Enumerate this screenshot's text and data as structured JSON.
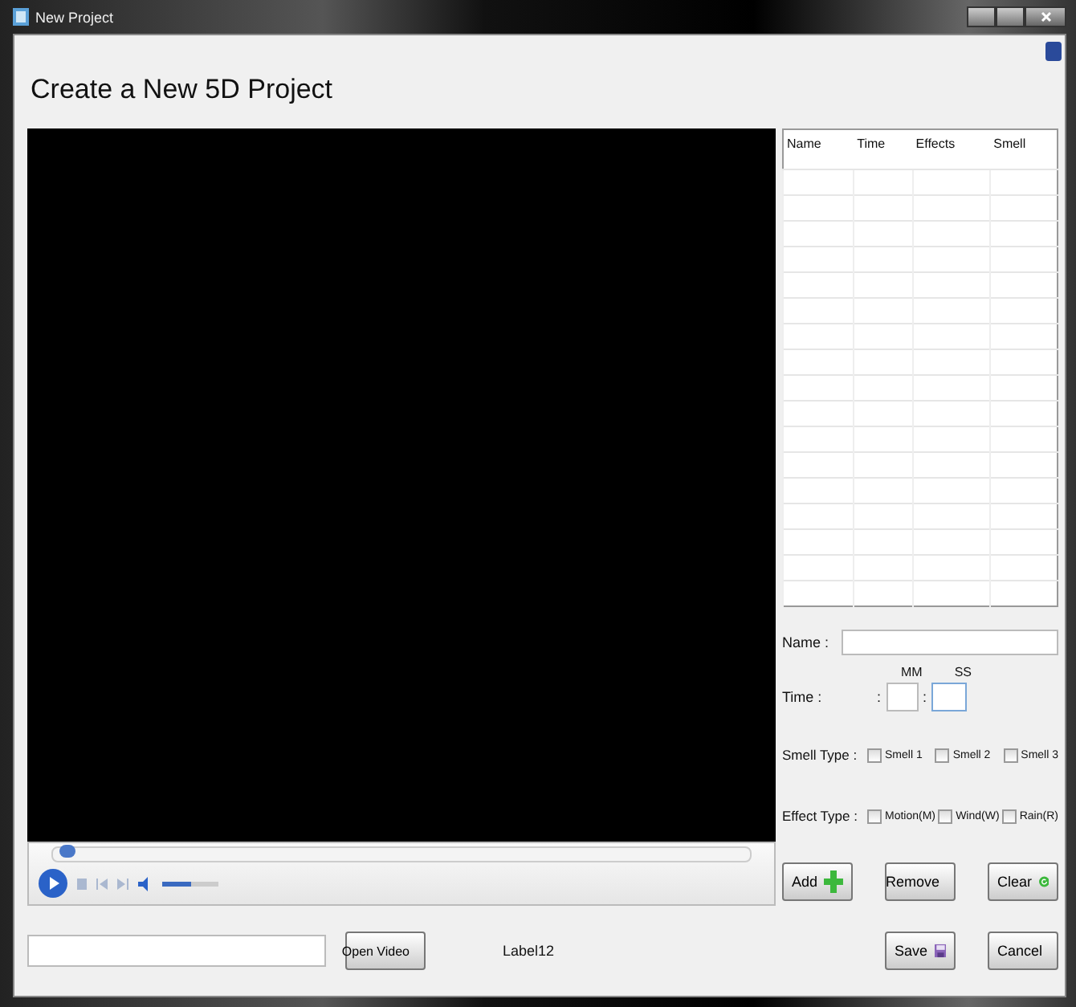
{
  "window": {
    "title": "New Project"
  },
  "heading": "Create a New 5D Project",
  "player": {
    "seek": {
      "level": 0.01
    },
    "volume": {
      "level": 0.5
    }
  },
  "table": {
    "columns": [
      "Name",
      "Time",
      "Effects",
      "Smell"
    ]
  },
  "name_field": {
    "label": "Name :"
  },
  "time": {
    "label": "Time :",
    "mm_label": "MM",
    "ss_label": "SS",
    "separator": ":"
  },
  "smell_type": {
    "label": "Smell Type :",
    "options": [
      {
        "label": "Smell 1",
        "checked": false
      },
      {
        "label": "Smell 2",
        "checked": false
      },
      {
        "label": "Smell 3",
        "checked": false
      }
    ]
  },
  "effect_type": {
    "label": "Effect Type :",
    "options": [
      {
        "label": "Motion(M)",
        "checked": false
      },
      {
        "label": "Wind(W)",
        "checked": false
      },
      {
        "label": "Rain(R)",
        "checked": false
      }
    ]
  },
  "list_buttons": [
    {
      "label": "Add",
      "kind": "add"
    },
    {
      "label": "Remove",
      "kind": "remove"
    },
    {
      "label": "Clear",
      "kind": "clear"
    }
  ],
  "open_video": {
    "label": "Open Video"
  },
  "status_label": "Label12",
  "dialog_buttons": [
    {
      "label": "Save",
      "kind": "save"
    },
    {
      "label": "Cancel",
      "kind": "cancel"
    }
  ]
}
